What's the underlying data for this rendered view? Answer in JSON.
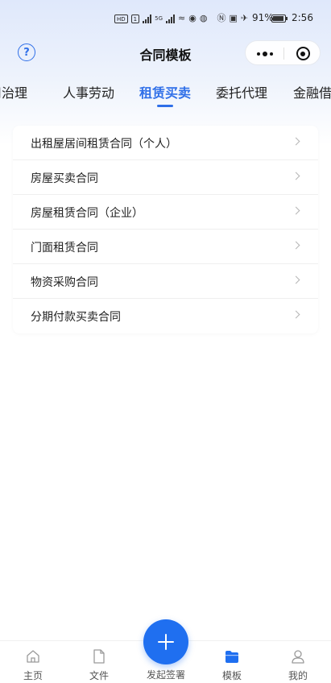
{
  "status_bar": {
    "hd_badge": "HD",
    "sim_badge": "1",
    "signal_1": "5G",
    "signal_2": "5G",
    "battery_percent": "91%",
    "time": "2:56"
  },
  "nav": {
    "title": "合同模板",
    "help_glyph": "?"
  },
  "tabs": [
    {
      "label": "公司治理"
    },
    {
      "label": "人事劳动"
    },
    {
      "label": "租赁买卖",
      "active": true
    },
    {
      "label": "委托代理"
    },
    {
      "label": "金融借贷"
    }
  ],
  "list": {
    "items": [
      {
        "label": "出租屋居间租赁合同（个人）"
      },
      {
        "label": "房屋买卖合同"
      },
      {
        "label": "房屋租赁合同（企业）"
      },
      {
        "label": "门面租赁合同"
      },
      {
        "label": "物资采购合同"
      },
      {
        "label": "分期付款买卖合同"
      }
    ]
  },
  "tabbar": {
    "items": [
      {
        "label": "主页",
        "icon": "home-icon"
      },
      {
        "label": "文件",
        "icon": "file-icon"
      },
      {
        "label": "发起签署",
        "icon": "plus-icon"
      },
      {
        "label": "模板",
        "icon": "folder-icon",
        "active": true
      },
      {
        "label": "我的",
        "icon": "user-icon"
      }
    ]
  },
  "colors": {
    "accent": "#2f6fe8",
    "fab": "#1f6ff0",
    "text": "#222222"
  }
}
